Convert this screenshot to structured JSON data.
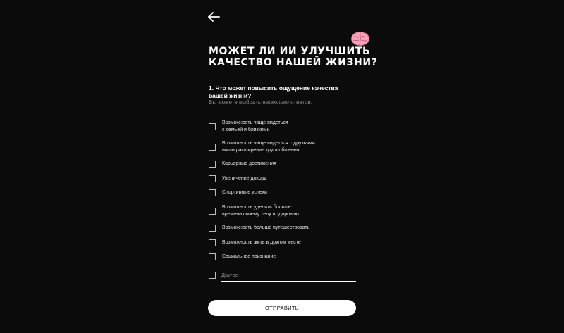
{
  "header": {
    "back_icon": "arrow-left-icon",
    "emoji_icon": "brain-icon"
  },
  "survey": {
    "title": "МОЖЕТ ЛИ ИИ УЛУЧШИТЬ КАЧЕСТВО НАШЕЙ ЖИЗНИ?",
    "question": "1. Что может повысить ощущение качества вашей жизни?",
    "hint": "Вы можете выбрать несколько ответов.",
    "options": [
      {
        "label": "Возможность чаще видеться\nс семьей и близкими",
        "checked": false
      },
      {
        "label": "Возможность чаще видеться с друзьями\nи/или расширение круга общения",
        "checked": false
      },
      {
        "label": "Карьерные достижения",
        "checked": false
      },
      {
        "label": "Увеличение дохода",
        "checked": false
      },
      {
        "label": "Спортивные успехи",
        "checked": false
      },
      {
        "label": "Возможность уделять больше\nвремени своему телу и здоровью",
        "checked": false
      },
      {
        "label": "Возможность больше путешествовать",
        "checked": false
      },
      {
        "label": "Возможность жить в другом месте",
        "checked": false
      },
      {
        "label": "Социальное признание",
        "checked": false
      }
    ],
    "other": {
      "placeholder": "Другое",
      "value": "",
      "checked": false
    },
    "submit_label": "ОТПРАВИТЬ"
  }
}
